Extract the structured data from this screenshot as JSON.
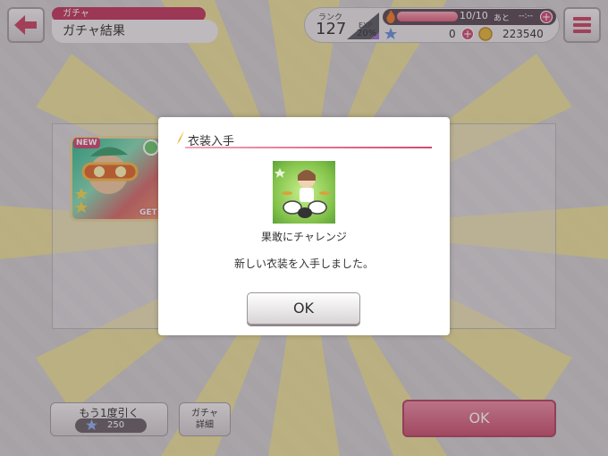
{
  "header": {
    "section_tab": "ガチャ",
    "title": "ガチャ結果"
  },
  "status": {
    "rank_label": "ランク",
    "rank": "127",
    "exp_label": "EXP",
    "exp_pct": "20%",
    "stamina": "10/10",
    "stamina_remaining_label": "あと",
    "stamina_time": "--:--",
    "stars": "0",
    "coins": "223540"
  },
  "draw_again": {
    "label": "もう1度引く",
    "cost": "250"
  },
  "gacha_detail_line1": "ガチャ",
  "gacha_detail_line2": "詳細",
  "bottom_ok": "OK",
  "card_badge": "NEW",
  "card_get": "GET",
  "modal": {
    "title": "衣装入手",
    "item_name": "果敢にチャレンジ",
    "message": "新しい衣装を入手しました。",
    "ok": "OK"
  },
  "colors": {
    "accent": "#c9506f",
    "title_bar": "#c1385f",
    "item_bg": "#82c24a"
  }
}
